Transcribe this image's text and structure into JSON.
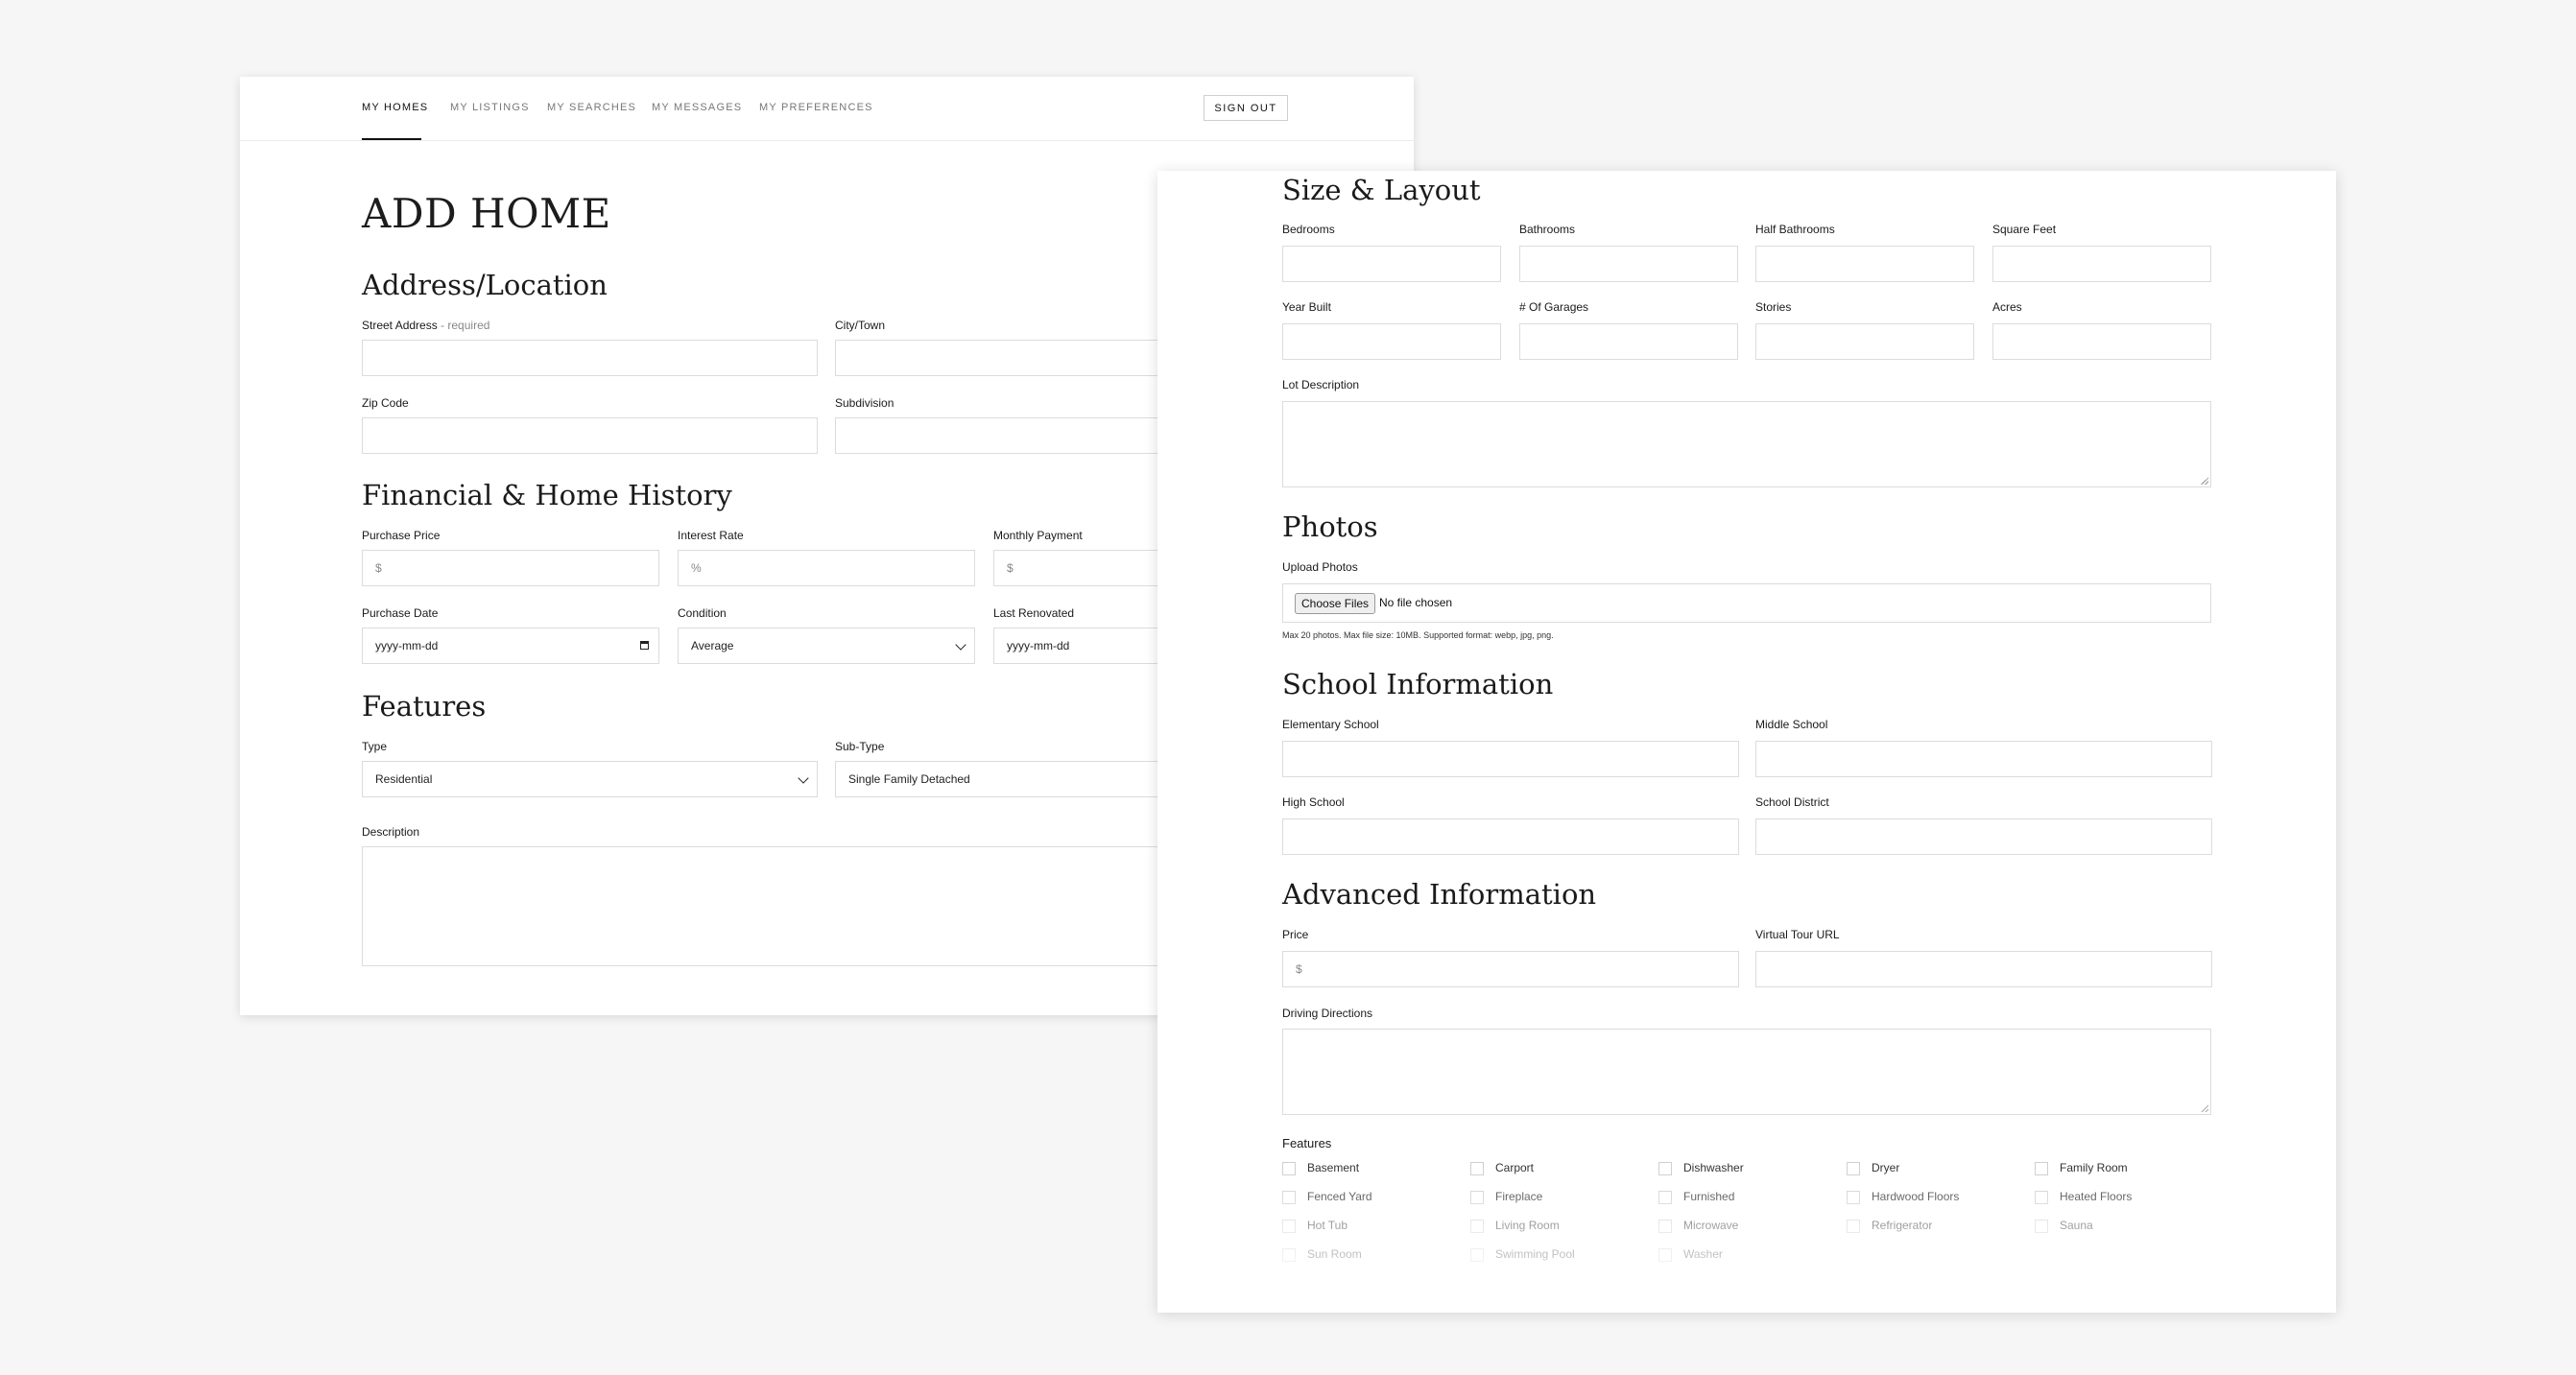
{
  "nav": {
    "items": [
      {
        "label": "MY HOMES",
        "active": true
      },
      {
        "label": "MY LISTINGS",
        "active": false
      },
      {
        "label": "MY SEARCHES",
        "active": false
      },
      {
        "label": "MY MESSAGES",
        "active": false
      },
      {
        "label": "MY PREFERENCES",
        "active": false
      }
    ],
    "sign_out": "SIGN OUT"
  },
  "page_title": "ADD HOME",
  "address": {
    "heading": "Address/Location",
    "street_label": "Street Address",
    "street_required": " - required",
    "city_label": "City/Town",
    "zip_label": "Zip Code",
    "subdivision_label": "Subdivision"
  },
  "financial": {
    "heading": "Financial & Home History",
    "purchase_price_label": "Purchase Price",
    "purchase_price_placeholder": "$",
    "interest_rate_label": "Interest Rate",
    "interest_rate_placeholder": "%",
    "monthly_payment_label": "Monthly Payment",
    "monthly_payment_placeholder": "$",
    "purchase_date_label": "Purchase Date",
    "purchase_date_value": "yyyy-mm-dd",
    "condition_label": "Condition",
    "condition_value": "Average",
    "last_renovated_label": "Last Renovated",
    "last_renovated_value": "yyyy-mm-dd"
  },
  "features_section": {
    "heading": "Features",
    "type_label": "Type",
    "type_value": "Residential",
    "subtype_label": "Sub-Type",
    "subtype_value": "Single Family Detached",
    "description_label": "Description"
  },
  "size_layout": {
    "heading": "Size & Layout",
    "bedrooms_label": "Bedrooms",
    "bathrooms_label": "Bathrooms",
    "half_bathrooms_label": "Half Bathrooms",
    "square_feet_label": "Square Feet",
    "year_built_label": "Year Built",
    "garages_label": "# Of Garages",
    "stories_label": "Stories",
    "acres_label": "Acres",
    "lot_description_label": "Lot Description"
  },
  "photos": {
    "heading": "Photos",
    "upload_label": "Upload Photos",
    "choose_button": "Choose Files",
    "no_file": "No file chosen",
    "hint": "Max 20 photos. Max file size: 10MB. Supported format: webp, jpg, png."
  },
  "school": {
    "heading": "School Information",
    "elementary_label": "Elementary School",
    "middle_label": "Middle School",
    "high_label": "High School",
    "district_label": "School District"
  },
  "advanced": {
    "heading": "Advanced Information",
    "price_label": "Price",
    "price_placeholder": "$",
    "virtual_tour_label": "Virtual Tour URL",
    "driving_directions_label": "Driving Directions",
    "features_label": "Features",
    "features": [
      "Basement",
      "Carport",
      "Dishwasher",
      "Dryer",
      "Family Room",
      "Fenced Yard",
      "Fireplace",
      "Furnished",
      "Hardwood Floors",
      "Heated Floors",
      "Hot Tub",
      "Living Room",
      "Microwave",
      "Refrigerator",
      "Sauna",
      "Sun Room",
      "Swimming Pool",
      "Washer"
    ]
  }
}
